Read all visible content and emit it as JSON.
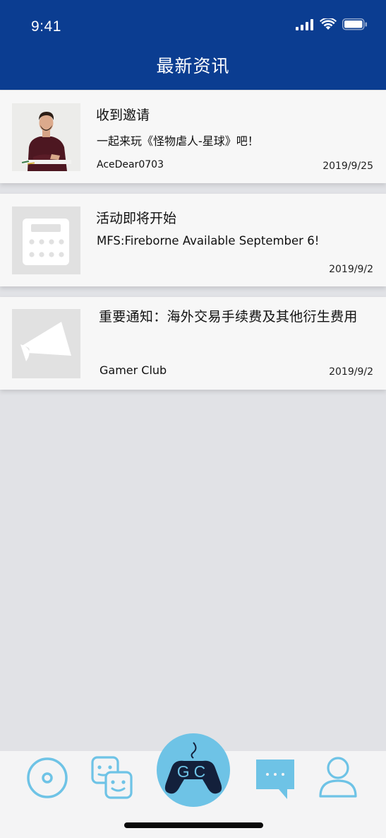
{
  "status_bar": {
    "time": "9:41"
  },
  "header": {
    "title": "最新资讯"
  },
  "news": [
    {
      "title": "收到邀请",
      "body": "一起来玩《怪物虐人-星球》吧！",
      "author": "AceDear0703",
      "date": "2019/9/25",
      "thumb": "person-photo"
    },
    {
      "title": "活动即将开始",
      "body": "MFS:Fireborne  Available September 6!",
      "author": "",
      "date": "2019/9/2",
      "thumb": "calculator-icon"
    },
    {
      "title": "重要通知：海外交易手续费及其他衍生费用",
      "body": "",
      "author": "Gamer Club",
      "date": "2019/9/2",
      "thumb": "megaphone-icon"
    }
  ],
  "tabbar": {
    "tabs": [
      {
        "icon": "disc-icon"
      },
      {
        "icon": "smiley-faces-icon"
      },
      {
        "icon": "gamepad-icon",
        "logo_text": "GC"
      },
      {
        "icon": "chat-bubble-icon"
      },
      {
        "icon": "user-icon"
      }
    ]
  },
  "colors": {
    "header_bg": "#0b3d91",
    "accent": "#6ec3e6",
    "page_bg": "#e1e2e6",
    "card_bg": "#f7f7f7"
  }
}
